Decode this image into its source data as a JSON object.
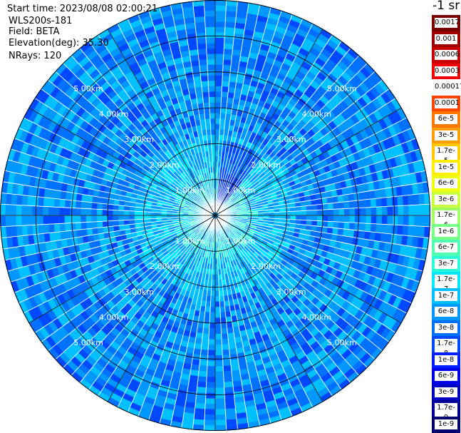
{
  "info": {
    "start_time": "Start time: 2023/08/08 02:00:21",
    "instrument": "WLS200s-181",
    "field": "Field: BETA",
    "elevation": "Elevation(deg): 35.30",
    "nrays": "NRays: 120"
  },
  "colorbar": {
    "unit_label": "-1 sr",
    "ticks": [
      "0.0017",
      "0.001",
      "0.0006",
      "0.0003",
      "0.00017",
      "0.0001",
      "6e-5",
      "3e-5",
      "1.7e-5",
      "1e-5",
      "6e-6",
      "3e-6",
      "1.7e-6",
      "1e-6",
      "6e-7",
      "3e-7",
      "1.7e-7",
      "1e-7",
      "6e-8",
      "3e-8",
      "1.7e-8",
      "1e-8",
      "6e-9",
      "3e-9",
      "1.7e-9",
      "1e-9"
    ],
    "colors": [
      "#7a0000",
      "#a00000",
      "#c80000",
      "#f00000",
      "#ffffff",
      "#ff4400",
      "#ff7800",
      "#ff9e00",
      "#ffc800",
      "#ffee00",
      "#f0ff10",
      "#c8ff40",
      "#a0ff60",
      "#78ff88",
      "#50ffb0",
      "#28ffd8",
      "#00e8ff",
      "#00c0ff",
      "#0098ff",
      "#0070ff",
      "#0048ff",
      "#0020ff",
      "#0000e8",
      "#0000c0",
      "#000098",
      "#000070"
    ]
  },
  "chart_data": {
    "type": "heatmap",
    "projection": "polar (PPI scan)",
    "range_rings_km": [
      1.0,
      2.0,
      3.0,
      4.0,
      5.0
    ],
    "ring_labels": [
      "1.00km",
      "2.00km",
      "3.00km",
      "4.00km",
      "5.00km"
    ],
    "max_range_km": 6.0,
    "n_rays": 120,
    "azimuth_spokes_deg": [
      0,
      30,
      60,
      90,
      120,
      150,
      180,
      210,
      240,
      270,
      300,
      330
    ],
    "field": "BETA",
    "value_range": [
      1e-09,
      0.0017
    ],
    "dominant_values": {
      "near_range_0_1km": "1e-7 to 3e-7",
      "far_range_2_6km": "6e-8 to 3e-8",
      "northeast_sector_near": "1.7e-8 to 1e-8"
    }
  }
}
